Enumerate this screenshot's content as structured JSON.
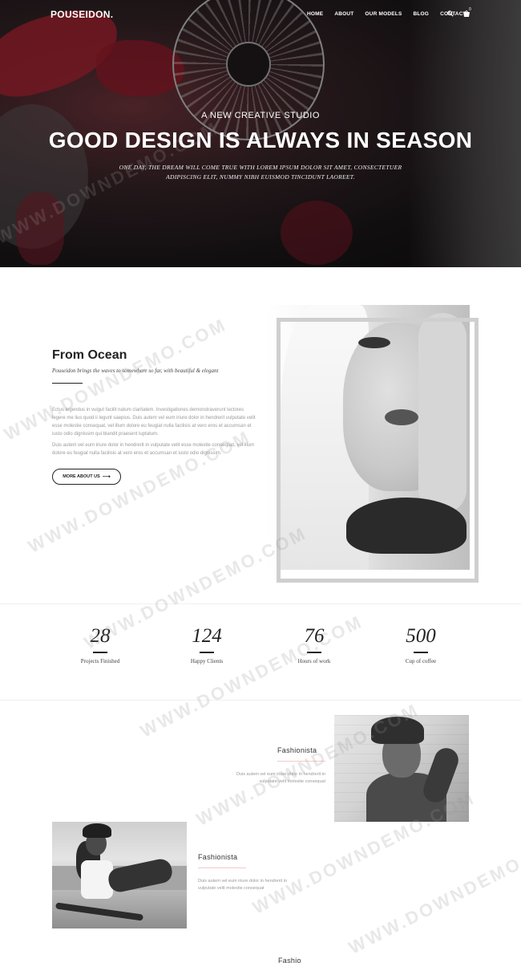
{
  "nav": {
    "logo": "POUSEIDON.",
    "menu": [
      "HOME",
      "ABOUT",
      "OUR MODELS",
      "BLOG",
      "CONTACT"
    ],
    "cart_count": "0"
  },
  "hero": {
    "tagline": "A NEW CREATIVE STUDIO",
    "headline": "GOOD DESIGN IS ALWAYS IN SEASON",
    "text": "ONE DAY, THE DREAM WILL COME TRUE WITH LOREM IPSUM DOLOR SIT AMET, CONSECTETUER ADIPISCING ELIT, NUMMY NIBH EUISMOD TINCIDUNT LAOREET."
  },
  "about": {
    "title": "From Ocean",
    "subtitle": "Pouseidon brings the waves to somewhere so far, with beautiful & elegant",
    "paragraph1": "Ectus legendus in vulgut facilit natum claritatem. Investigationes demonstraverunt lectores legere me lius quod ii legunt saepius. Duis autem vel eum iriure dolor in hendrerit vulputate velit esse molestie consequat, vel illum dolore eu feugiat nulla facilisis at vero eros et accumsan et iusto odio dignissim qui blandit praesent luptatum.",
    "paragraph2": "Duis autem vel eum iriure dolor in hendrerit in vulputate velit esse molestie consequat, vel illum dolore eu feugiat nulla facilisis at vero eros et accumsan et iusto odio dignissim.",
    "button": "MORE ABOUT US"
  },
  "stats": [
    {
      "number": "28",
      "label": "Projects Finished"
    },
    {
      "number": "124",
      "label": "Happy Clients"
    },
    {
      "number": "76",
      "label": "Hours of work"
    },
    {
      "number": "500",
      "label": "Cup of coffee"
    }
  ],
  "fashion": [
    {
      "title": "Fashionista",
      "text": "Duis autem vel eum iriure dolor in hendrerit in vulputate velit molestie consequat"
    },
    {
      "title": "Fashionista",
      "text": "Duis autem vel eum iriure dolor in hendrerit in vulputate velit molestie consequat"
    },
    {
      "title": "Fashio"
    }
  ],
  "watermark": "WWW.DOWNDEMO.COM"
}
